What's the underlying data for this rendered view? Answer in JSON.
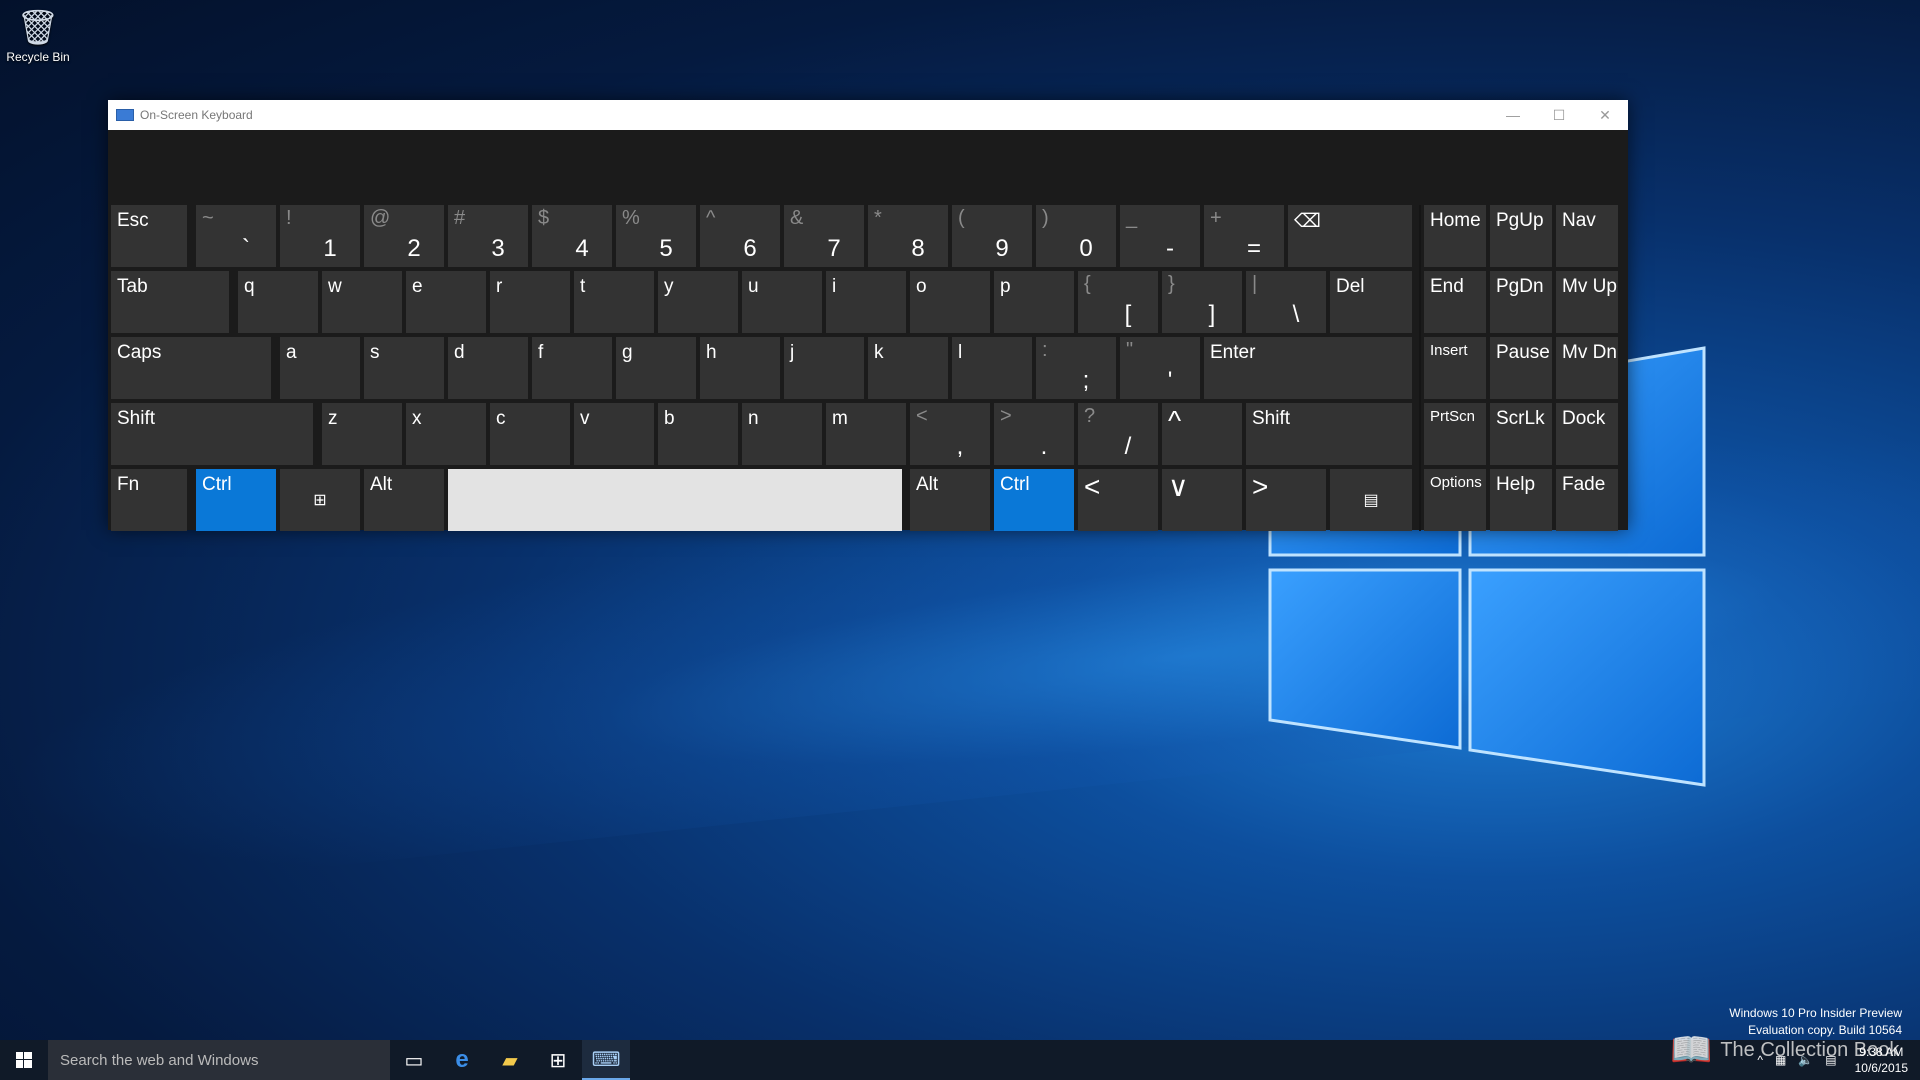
{
  "desktop": {
    "recycle_bin": "Recycle Bin"
  },
  "window": {
    "title": "On-Screen Keyboard"
  },
  "keyboard": {
    "row1": [
      {
        "type": "label",
        "text": "Esc"
      },
      {
        "shift": "~",
        "primary": "`"
      },
      {
        "shift": "!",
        "primary": "1"
      },
      {
        "shift": "@",
        "primary": "2"
      },
      {
        "shift": "#",
        "primary": "3"
      },
      {
        "shift": "$",
        "primary": "4"
      },
      {
        "shift": "%",
        "primary": "5"
      },
      {
        "shift": "^",
        "primary": "6"
      },
      {
        "shift": "&",
        "primary": "7"
      },
      {
        "shift": "*",
        "primary": "8"
      },
      {
        "shift": "(",
        "primary": "9"
      },
      {
        "shift": ")",
        "primary": "0"
      },
      {
        "shift": "_",
        "primary": "-"
      },
      {
        "shift": "+",
        "primary": "="
      },
      {
        "type": "label",
        "text": "⌫"
      }
    ],
    "row2": [
      {
        "type": "label",
        "text": "Tab"
      },
      {
        "type": "label",
        "text": "q"
      },
      {
        "type": "label",
        "text": "w"
      },
      {
        "type": "label",
        "text": "e"
      },
      {
        "type": "label",
        "text": "r"
      },
      {
        "type": "label",
        "text": "t"
      },
      {
        "type": "label",
        "text": "y"
      },
      {
        "type": "label",
        "text": "u"
      },
      {
        "type": "label",
        "text": "i"
      },
      {
        "type": "label",
        "text": "o"
      },
      {
        "type": "label",
        "text": "p"
      },
      {
        "shift": "{",
        "primary": "["
      },
      {
        "shift": "}",
        "primary": "]"
      },
      {
        "shift": "|",
        "primary": "\\"
      },
      {
        "type": "label",
        "text": "Del"
      }
    ],
    "row3": [
      {
        "type": "label",
        "text": "Caps"
      },
      {
        "type": "label",
        "text": "a"
      },
      {
        "type": "label",
        "text": "s"
      },
      {
        "type": "label",
        "text": "d"
      },
      {
        "type": "label",
        "text": "f"
      },
      {
        "type": "label",
        "text": "g"
      },
      {
        "type": "label",
        "text": "h"
      },
      {
        "type": "label",
        "text": "j"
      },
      {
        "type": "label",
        "text": "k"
      },
      {
        "type": "label",
        "text": "l"
      },
      {
        "shift": ":",
        "primary": ";"
      },
      {
        "shift": "\"",
        "primary": "'"
      },
      {
        "type": "label",
        "text": "Enter"
      }
    ],
    "row4": [
      {
        "type": "label",
        "text": "Shift"
      },
      {
        "type": "label",
        "text": "z"
      },
      {
        "type": "label",
        "text": "x"
      },
      {
        "type": "label",
        "text": "c"
      },
      {
        "type": "label",
        "text": "v"
      },
      {
        "type": "label",
        "text": "b"
      },
      {
        "type": "label",
        "text": "n"
      },
      {
        "type": "label",
        "text": "m"
      },
      {
        "shift": "<",
        "primary": ","
      },
      {
        "shift": ">",
        "primary": "."
      },
      {
        "shift": "?",
        "primary": "/"
      },
      {
        "type": "arrow",
        "text": "^"
      },
      {
        "type": "label",
        "text": "Shift"
      }
    ],
    "row5": [
      {
        "type": "label",
        "text": "Fn"
      },
      {
        "type": "label",
        "text": "Ctrl",
        "style": "blue"
      },
      {
        "type": "center",
        "text": "⊞"
      },
      {
        "type": "label",
        "text": "Alt"
      },
      {
        "type": "space",
        "text": ""
      },
      {
        "type": "label",
        "text": "Alt"
      },
      {
        "type": "label",
        "text": "Ctrl",
        "style": "blue"
      },
      {
        "type": "arrow",
        "text": "<"
      },
      {
        "type": "arrow",
        "text": "∨"
      },
      {
        "type": "arrow",
        "text": ">"
      },
      {
        "type": "center",
        "text": "▤"
      }
    ],
    "nav": [
      [
        "Home",
        "PgUp",
        "Nav"
      ],
      [
        "End",
        "PgDn",
        "Mv Up"
      ],
      [
        "Insert",
        "Pause",
        "Mv Dn"
      ],
      [
        "PrtScn",
        "ScrLk",
        "Dock"
      ],
      [
        "Options",
        "Help",
        "Fade"
      ]
    ]
  },
  "taskbar": {
    "search_placeholder": "Search the web and Windows",
    "watermark_line1": "Windows 10 Pro Insider Preview",
    "watermark_line2": "Evaluation copy. Build 10564",
    "time": "9:38 AM",
    "date": "10/6/2015",
    "brand": "The Collection Book"
  }
}
